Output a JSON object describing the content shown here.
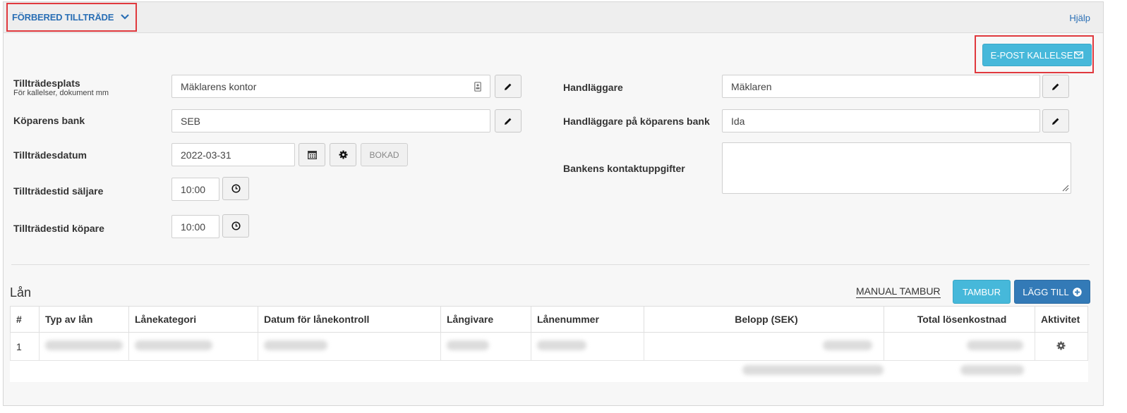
{
  "header": {
    "section_title": "FÖRBERED TILLTRÄDE",
    "help_label": "Hjälp"
  },
  "actions": {
    "email_label": "E-POST KALLELSE"
  },
  "form": {
    "access_place": {
      "label": "Tillträdesplats",
      "sublabel": "För kallelser, dokument mm",
      "value": "Mäklarens kontor"
    },
    "buyer_bank": {
      "label": "Köparens bank",
      "value": "SEB"
    },
    "access_date": {
      "label": "Tillträdesdatum",
      "value": "2022-03-31",
      "booked_label": "BOKAD"
    },
    "seller_time": {
      "label": "Tillträdestid säljare",
      "value": "10:00"
    },
    "buyer_time": {
      "label": "Tillträdestid köpare",
      "value": "10:00"
    },
    "handler": {
      "label": "Handläggare",
      "value": "Mäklaren"
    },
    "bank_handler": {
      "label": "Handläggare på köparens bank",
      "value": "Ida"
    },
    "bank_contact": {
      "label": "Bankens kontaktuppgifter",
      "value": ""
    }
  },
  "loans": {
    "title": "Lån",
    "manual_tambur_label": "MANUAL TAMBUR",
    "tambur_label": "TAMBUR",
    "add_label": "LÄGG TILL",
    "columns": [
      "#",
      "Typ av lån",
      "Lånekategori",
      "Datum för lånekontroll",
      "Långivare",
      "Lånenummer",
      "Belopp (SEK)",
      "Total lösenkostnad",
      "Aktivitet"
    ],
    "rows": [
      {
        "num": "1"
      }
    ]
  },
  "icons": {
    "chevron": "chevron-down-icon",
    "contact_card": "contact-card-icon",
    "pencil": "pencil-icon",
    "calendar": "calendar-icon",
    "gear": "gear-icon",
    "clock": "clock-icon",
    "envelope": "envelope-icon",
    "plus_circle": "plus-circle-icon"
  },
  "colors": {
    "link": "#2a6fb5",
    "info_button": "#46b8da",
    "primary_button": "#337ab7",
    "highlight_frame": "#e0393e"
  }
}
